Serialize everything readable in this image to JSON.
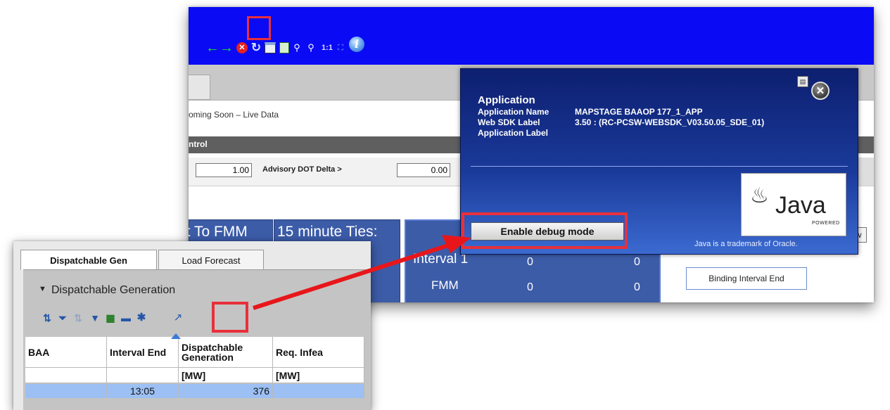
{
  "toolbar": {
    "zoom_label": "1:1",
    "buttons": [
      "back-arrow",
      "forward-arrow",
      "stop",
      "refresh",
      "print",
      "export",
      "zoom-out",
      "zoom-in",
      "zoom-1-1",
      "fit",
      "info"
    ]
  },
  "main": {
    "status_text": "oming Soon – Live Data",
    "control_bar_text": "ntrol",
    "input_a_value": "1.00",
    "advisory_label": "Advisory DOT Delta >",
    "input_b_value": "0.00",
    "panels": {
      "fmm_title": "nt To FMM",
      "ties_title": "15 minute Ties:",
      "interval_label": "Interval 1",
      "fmm_label": "FMM",
      "values": [
        "0",
        "0",
        "0",
        "0"
      ]
    },
    "binding_button_label": "Binding Interval End"
  },
  "info_popup": {
    "title": "Application",
    "rows": [
      {
        "label": "Application Name",
        "value": "MAPSTAGE BAAOP 177_1_APP"
      },
      {
        "label": "Web SDK Label",
        "value": "3.50 : (RC-PCSW-WEBSDK_V03.50.05_SDE_01)"
      },
      {
        "label": "Application Label",
        "value": ""
      }
    ],
    "debug_button_label": "Enable debug mode",
    "java_word": "Java",
    "java_powered": "POWERED",
    "java_trademark": "Java is a trademark of Oracle."
  },
  "front": {
    "tabs": [
      "Dispatchable Gen",
      "Load Forecast"
    ],
    "section_title": "Dispatchable Generation",
    "grid": {
      "headers": [
        "BAA",
        "Interval End",
        "Dispatchable Generation",
        "Req. Infea"
      ],
      "units": [
        "",
        "",
        "[MW]",
        "[MW]"
      ],
      "rows": [
        [
          "",
          "13:05",
          "376",
          ""
        ]
      ]
    }
  },
  "colors": {
    "toolbar_blue": "#0a0af5",
    "highlight_red": "#e8303a",
    "panel_blue": "#3c5ca8",
    "popup_blue": "#1a3a9a",
    "selected_row": "#9cc0f4"
  }
}
